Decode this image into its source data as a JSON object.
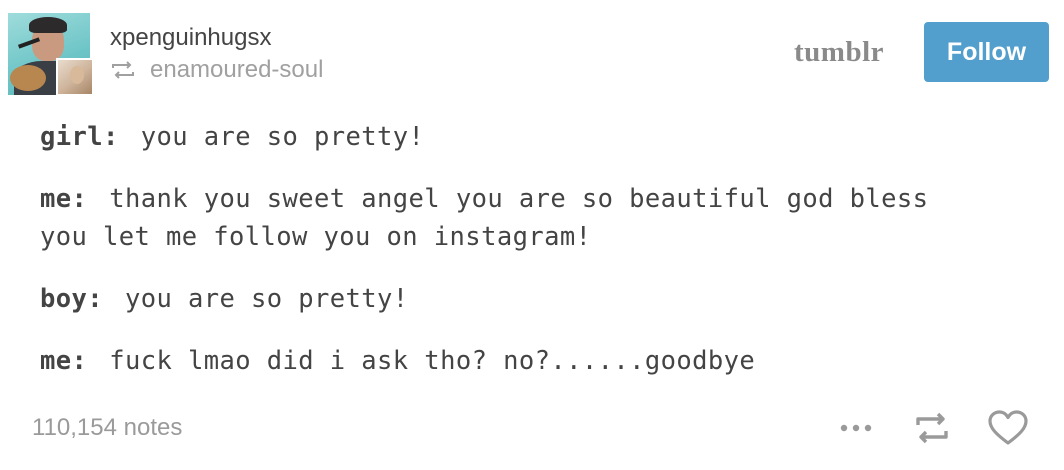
{
  "post": {
    "username": "xpenguinhugsx",
    "reblogged_from": "enamoured-soul",
    "brand": "tumblr",
    "follow_label": "Follow",
    "dialogue": [
      {
        "speaker": "girl:",
        "lines": [
          "you are so pretty!"
        ]
      },
      {
        "speaker": "me:",
        "lines": [
          "thank you sweet angel you are so beautiful god bless",
          "you let me follow you on instagram!"
        ]
      },
      {
        "speaker": "boy:",
        "lines": [
          "you are so pretty!"
        ]
      },
      {
        "speaker": "me:",
        "lines": [
          "fuck lmao did i ask tho? no?......goodbye"
        ]
      }
    ],
    "notes": "110,154 notes"
  },
  "colors": {
    "follow_button": "#529ecc",
    "text": "#444444",
    "muted": "#9a9a9a"
  },
  "icons": [
    "reblog-icon",
    "more-icon",
    "reblog-action-icon",
    "heart-icon"
  ]
}
